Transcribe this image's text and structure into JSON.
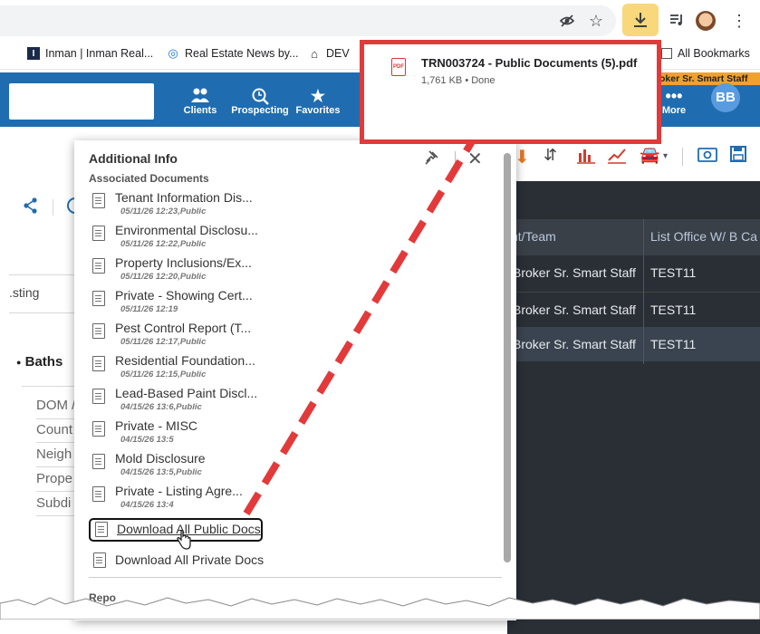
{
  "browser": {
    "bookmarks": [
      {
        "label": "Inman | Inman Real...",
        "icon": "inman-favicon"
      },
      {
        "label": "Real Estate News by...",
        "icon": "broadcast-favicon"
      },
      {
        "label": "DEV",
        "icon": "home-icon"
      }
    ],
    "all_bookmarks_label": "All Bookmarks"
  },
  "download_bubble": {
    "filename": "TRN003724 - Public Documents (5).pdf",
    "status": "1,761 KB • Done",
    "icon_label": "PDF"
  },
  "app_nav": {
    "items": [
      {
        "label": "Clients",
        "icon": "clients-icon"
      },
      {
        "label": "Prospecting",
        "icon": "prospecting-icon"
      },
      {
        "label": "Favorites",
        "icon": "star-icon"
      },
      {
        "label": "More",
        "icon": "more-icon"
      }
    ],
    "orange_label": "oker Sr. Smart Staff",
    "avatar_initials": "BB"
  },
  "background_grid": {
    "headers": [
      "nt/Team",
      "List Office W/ B Ca"
    ],
    "rows": [
      [
        "Broker Sr. Smart Staff",
        "TEST11"
      ],
      [
        "Broker Sr. Smart Staff",
        "TEST11"
      ],
      [
        "Broker Sr. Smart Staff",
        "TEST11"
      ]
    ]
  },
  "left_panel": {
    "listing_fragment": ".sting",
    "baths": "Baths",
    "fields": [
      "DOM /",
      "Count",
      "Neigh",
      "Prope",
      "Subdi"
    ]
  },
  "panel": {
    "title": "Additional Info",
    "subtitle": "Associated Documents",
    "documents": [
      {
        "name": "Tenant Information Dis...",
        "meta": "05/11/26 12:23,Public"
      },
      {
        "name": "Environmental Disclosu...",
        "meta": "05/11/26 12:22,Public"
      },
      {
        "name": "Property Inclusions/Ex...",
        "meta": "05/11/26 12:20,Public"
      },
      {
        "name": "Private - Showing Cert...",
        "meta": "05/11/26 12:19"
      },
      {
        "name": "Pest Control Report (T...",
        "meta": "05/11/26 12:17,Public"
      },
      {
        "name": "Residential Foundation...",
        "meta": "05/11/26 12:15,Public"
      },
      {
        "name": "Lead-Based Paint Discl...",
        "meta": "04/15/26 13:6,Public"
      },
      {
        "name": "Private - MISC",
        "meta": "04/15/26 13:5"
      },
      {
        "name": "Mold Disclosure",
        "meta": "04/15/26 13:5,Public"
      },
      {
        "name": "Private - Listing Agre...",
        "meta": "04/15/26 13:4"
      }
    ],
    "download_public": "Download All Public Docs",
    "download_private": "Download All Private Docs",
    "footer_fragment": "Repo"
  },
  "colors": {
    "header_blue": "#1f6db0",
    "highlight_red": "#e23a3a",
    "download_button": "#f8d87a"
  }
}
